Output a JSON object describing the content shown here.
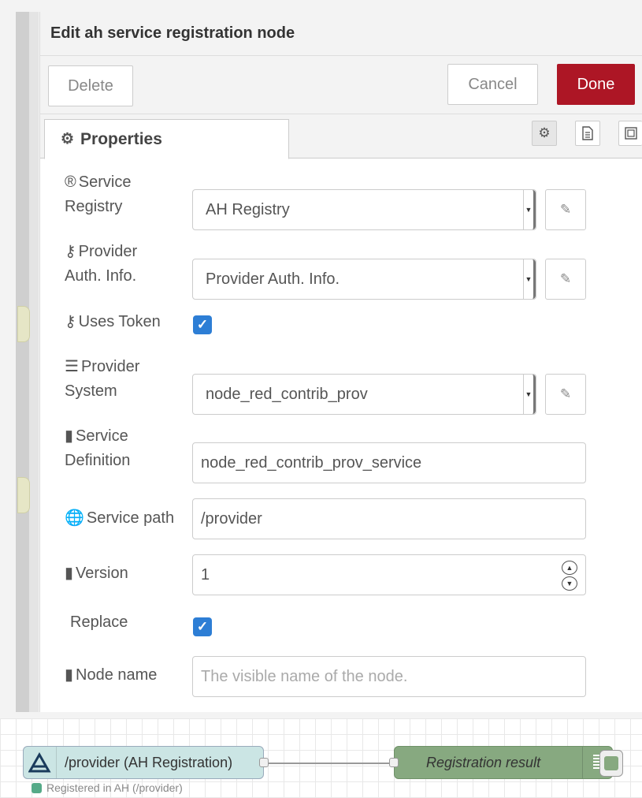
{
  "tray": {
    "title": "Edit ah service registration node",
    "delete_label": "Delete",
    "cancel_label": "Cancel",
    "done_label": "Done",
    "tab_properties": "Properties"
  },
  "form": {
    "service_registry": {
      "label_line1": "Service",
      "label_line2": "Registry",
      "value": "AH Registry"
    },
    "provider_auth": {
      "label_line1": "Provider",
      "label_line2": "Auth. Info.",
      "value": "Provider Auth. Info."
    },
    "uses_token": {
      "label": "Uses Token",
      "checked": true
    },
    "provider_system": {
      "label_line1": "Provider",
      "label_line2": "System",
      "value": "node_red_contrib_prov"
    },
    "service_definition": {
      "label_line1": "Service",
      "label_line2": "Definition",
      "value": "node_red_contrib_prov_service"
    },
    "service_path": {
      "label": "Service path",
      "value": "/provider"
    },
    "version": {
      "label": "Version",
      "value": "1"
    },
    "replace": {
      "label": "Replace",
      "checked": true
    },
    "node_name": {
      "label": "Node name",
      "placeholder": "The visible name of the node."
    }
  },
  "workspace": {
    "ah_node_label": "/provider (AH Registration)",
    "ah_node_status": "Registered in AH (/provider)",
    "result_node_label": "Registration result"
  },
  "colors": {
    "done": "#ad1625",
    "checkbox": "#2d7ed5",
    "ah_node": "#cbe5e4",
    "debug_node": "#87a980"
  }
}
